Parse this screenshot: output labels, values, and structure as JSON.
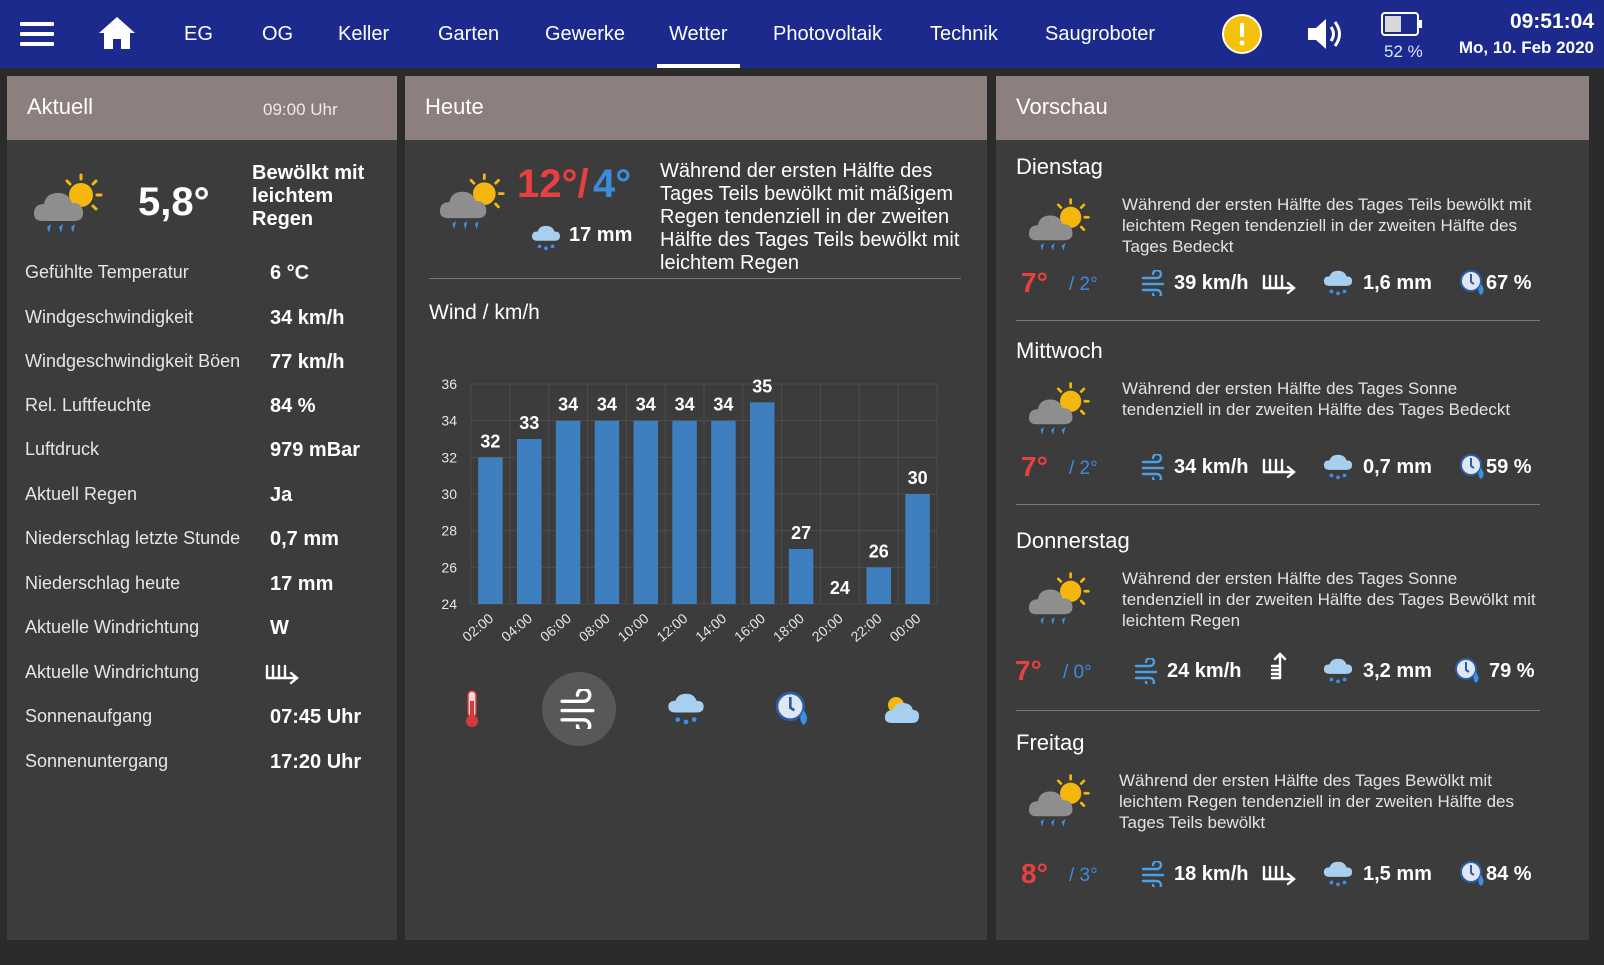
{
  "nav": {
    "tabs": [
      "EG",
      "OG",
      "Keller",
      "Garten",
      "Gewerke",
      "Wetter",
      "Photovoltaik",
      "Technik",
      "Saugroboter"
    ],
    "active_tab": "Wetter",
    "battery": "52 %",
    "time": "09:51:04",
    "date": "Mo, 10. Feb 2020",
    "colors": {
      "bar": "#1c2a8e",
      "warning": "#f4c20d"
    }
  },
  "aktuell": {
    "title": "Aktuell",
    "time": "09:00 Uhr",
    "temp": "5,8°",
    "desc": "Bewölkt mit leichtem Regen",
    "rows": [
      {
        "label": "Gefühlte Temperatur",
        "value": "6 °C"
      },
      {
        "label": "Windgeschwindigkeit",
        "value": "34 km/h"
      },
      {
        "label": "Windgeschwindigkeit Böen",
        "value": "77 km/h"
      },
      {
        "label": "Rel. Luftfeuchte",
        "value": "84 %"
      },
      {
        "label": "Luftdruck",
        "value": "979 mBar"
      },
      {
        "label": "Aktuell Regen",
        "value": "Ja"
      },
      {
        "label": "Niederschlag letzte Stunde",
        "value": "0,7 mm"
      },
      {
        "label": "Niederschlag heute",
        "value": "17 mm"
      },
      {
        "label": "Aktuelle Windrichtung",
        "value": "W"
      },
      {
        "label": "Aktuelle Windrichtung",
        "value": ""
      },
      {
        "label": "Sonnenaufgang",
        "value": "07:45 Uhr"
      },
      {
        "label": "Sonnenuntergang",
        "value": "17:20 Uhr"
      }
    ]
  },
  "heute": {
    "title": "Heute",
    "max": "12°/",
    "min": "4°",
    "rain": "17 mm",
    "text": "Während der ersten Hälfte des Tages Teils bewölkt mit mäßigem Regen tendenziell in der zweiten Hälfte des Tages Teils bewölkt mit leichtem Regen",
    "chart_title": "Wind / km/h",
    "modes": [
      "temperature-icon",
      "wind-icon",
      "rain-icon",
      "humidity-icon",
      "sun-cloud-icon"
    ],
    "active_mode": "wind-icon"
  },
  "chart_data": {
    "type": "bar",
    "categories": [
      "02:00",
      "04:00",
      "06:00",
      "08:00",
      "10:00",
      "12:00",
      "14:00",
      "16:00",
      "18:00",
      "20:00",
      "22:00",
      "00:00"
    ],
    "values": [
      32,
      33,
      34,
      34,
      34,
      34,
      34,
      35,
      27,
      24,
      26,
      30
    ],
    "ylim": [
      24,
      36
    ],
    "yticks": [
      24,
      26,
      28,
      30,
      32,
      34,
      36
    ],
    "title": "Wind / km/h",
    "xlabel": "",
    "ylabel": "",
    "grid": true,
    "bar_color": "#3d7fbf"
  },
  "vorschau": {
    "title": "Vorschau",
    "days": [
      {
        "name": "Dienstag",
        "text": "Während der ersten Hälfte des Tages Teils bewölkt mit leichtem Regen tendenziell in der zweiten Hälfte des Tages Bedeckt",
        "max": "7°",
        "min": "/ 2°",
        "wind": "39 km/h",
        "dir": "west",
        "rain": "1,6 mm",
        "hum": "67 %"
      },
      {
        "name": "Mittwoch",
        "text": "Während der ersten Hälfte des Tages Sonne tendenziell in der zweiten Hälfte des Tages Bedeckt",
        "max": "7°",
        "min": "/ 2°",
        "wind": "34 km/h",
        "dir": "west",
        "rain": "0,7 mm",
        "hum": "59 %"
      },
      {
        "name": "Donnerstag",
        "text": "Während der ersten Hälfte des Tages Sonne tendenziell in der zweiten Hälfte des Tages Bewölkt mit leichtem Regen",
        "max": "7°",
        "min": "/ 0°",
        "wind": "24 km/h",
        "dir": "north",
        "rain": "3,2 mm",
        "hum": "79 %"
      },
      {
        "name": "Freitag",
        "text": "Während der ersten Hälfte des Tages Bewölkt mit leichtem Regen tendenziell in der zweiten Hälfte des Tages Teils bewölkt",
        "max": "8°",
        "min": "/ 3°",
        "wind": "18 km/h",
        "dir": "west",
        "rain": "1,5 mm",
        "hum": "84 %"
      }
    ]
  }
}
